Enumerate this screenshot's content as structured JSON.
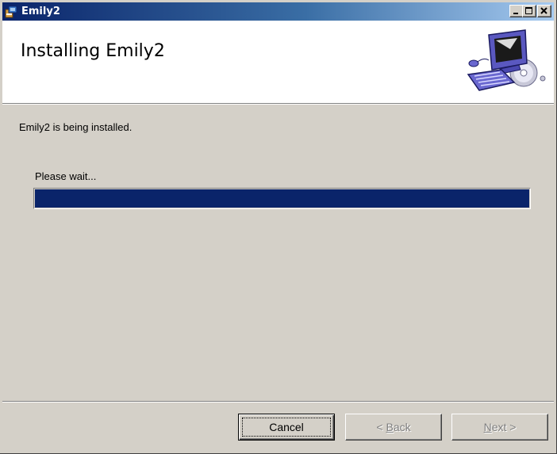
{
  "window": {
    "title": "Emily2",
    "controls": {
      "minimize_icon": "minimize-icon",
      "maximize_icon": "maximize-icon",
      "close_icon": "close-icon"
    }
  },
  "header": {
    "title": "Installing Emily2",
    "graphic_icon": "computer-cd-icon"
  },
  "body": {
    "status": "Emily2 is being installed.",
    "wait": "Please wait...",
    "progress_percent": 100
  },
  "buttons": {
    "cancel": "Cancel",
    "back_prefix": "< ",
    "back_mnemonic": "B",
    "back_rest": "ack",
    "next_mnemonic": "N",
    "next_rest": "ext >"
  },
  "colors": {
    "titlebar_start": "#0a246a",
    "progress_fill": "#0a246a",
    "dialog_face": "#d4d0c8"
  }
}
